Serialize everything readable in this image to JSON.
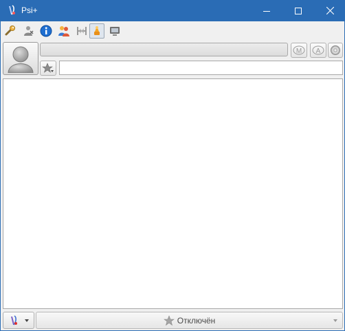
{
  "window": {
    "title": "Psi+"
  },
  "toolbar": {
    "icons": [
      "options-wrench-icon",
      "add-contact-icon",
      "info-icon",
      "groupchat-icon",
      "xml-console-icon",
      "show-offline-icon",
      "show-agents-icon"
    ],
    "active_index": 5
  },
  "status_panel": {
    "nickname": "",
    "status_message": "",
    "mood_label": "M",
    "activity_label": "A"
  },
  "status_bar": {
    "status_text": "Отключён"
  }
}
